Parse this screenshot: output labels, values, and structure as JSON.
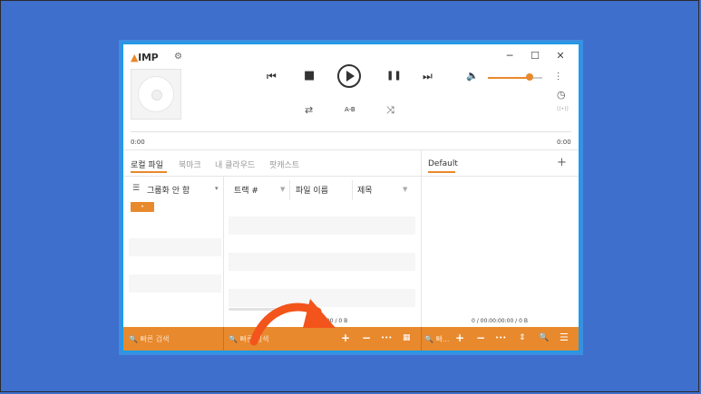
{
  "app": {
    "logo_text": "IMP",
    "logo_mark": "▲"
  },
  "header": {
    "gear": "⚙",
    "min": "─",
    "max": "☐",
    "close": "✕",
    "prev": "⏮",
    "stop": "■",
    "pause": "❚❚",
    "next": "⏭",
    "repeat": "⇄",
    "ab": "A-B",
    "shuffle": "⤨",
    "volume_icon": "🔈",
    "volume_level": 0.8,
    "eq_icon": "⫶",
    "timer_icon": "◷",
    "radio_icon": "((•))"
  },
  "seek": {
    "time_left": "0:00",
    "time_right": "0:00"
  },
  "tabs": [
    {
      "label": "로컬 파일"
    },
    {
      "label": "북마크"
    },
    {
      "label": "내 클라우드"
    },
    {
      "label": "팟캐스트"
    }
  ],
  "playlist": {
    "title": "Default",
    "add": "+",
    "status": "0 / 00:00:00:00 / 0 B"
  },
  "library": {
    "group_icon": "☰",
    "group_label": "그룹화 안 함",
    "group_caret": "▾",
    "chip": "•",
    "columns": [
      "트랙 #",
      "파일 이름",
      "제목"
    ],
    "filter_icon": "▼",
    "status": "/ 00 / 0 B"
  },
  "bottombar": {
    "search_placeholder_1": "🔍 빠른 검색",
    "search_placeholder_2": "🔍 빠른 검색",
    "add": "+",
    "remove": "−",
    "more": "•••",
    "grid": "▦",
    "search_short": "🔍 빠...",
    "pl_add": "+",
    "pl_remove": "−",
    "pl_more": "•••",
    "pl_sort": "⇕",
    "pl_search": "🔍",
    "pl_menu": "☰"
  },
  "colors": {
    "accent": "#e8892d",
    "desktop": "#3f6fcd",
    "window_border": "#1e9be8",
    "arrow": "#f2541b"
  }
}
